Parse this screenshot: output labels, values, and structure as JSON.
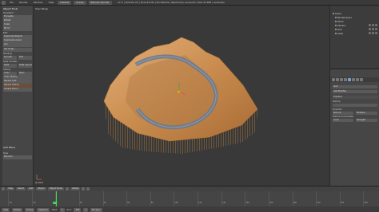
{
  "topbar": {
    "menus": [
      "File",
      "Render",
      "Window",
      "Help"
    ],
    "layout": "Default",
    "scene": "Scene",
    "engine": "Blender Render",
    "info": "v2.77 | Verts:62,172 | Faces:53,261 | Tris:106,522 | Objects:0/4 | Lamps:0/1 | Mem:43.90M | Landscape"
  },
  "left_panel": {
    "section": "Object Tools",
    "transform_label": "Transform:",
    "buttons": [
      "Translate",
      "Rotate",
      "Scale",
      "Mirror"
    ],
    "edit_label": "Edit:",
    "edit_buttons": [
      "Duplicate Objects",
      "Duplicate Linked",
      "Join"
    ],
    "set_origin": "Set Origin",
    "shading_label": "Shading:",
    "smooth": "Smooth",
    "flat": "Flat",
    "data_transfer_label": "Data Transfer:",
    "data_btn": "Data",
    "data_layout_btn": "Data Layout",
    "history_label": "History:",
    "undo": "Undo",
    "redo": "Redo",
    "undo_history": "Undo History",
    "repeat_last": "Repeat Last",
    "repeat_history": "Repeat History",
    "grease_pencil": "Grease Pencil",
    "add_plane": "Add Plane",
    "type_label": "Type",
    "type_value": "Random"
  },
  "viewport": {
    "label": "User Persp",
    "object_label": "(1) Grid"
  },
  "outliner": {
    "rows": [
      {
        "label": "Scene",
        "color": "grey"
      },
      {
        "label": "RenderLayers",
        "color": "grey"
      },
      {
        "label": "World",
        "color": "grey"
      },
      {
        "label": "Camera",
        "color": "grey"
      },
      {
        "label": "Grid",
        "color": "orange"
      },
      {
        "label": "Lamp",
        "color": "grey"
      }
    ]
  },
  "properties": {
    "object_name": "Grid",
    "modifier_button": "Add Modifier",
    "modifier_name": "Displace",
    "texture_label": "Texture",
    "direction_label": "Direction",
    "direction_value": "Normal",
    "texture_coords_label": "Texture Coordinates",
    "coords_value": "Local",
    "midlevel_label": "Midlevel",
    "strength_label": "Strength"
  },
  "view_header": {
    "view": "View",
    "select": "Select",
    "add": "Add",
    "object": "Object",
    "mode": "Object Mode",
    "pivot": "Global"
  },
  "timeline": {
    "ticks": [
      "-40",
      "-20",
      "0",
      "20",
      "40",
      "60",
      "80",
      "100",
      "120",
      "140",
      "160",
      "180",
      "200",
      "220",
      "240",
      "260"
    ],
    "current_frame": "1"
  },
  "timeline_footer": {
    "view": "View",
    "marker": "Marker",
    "frame": "Frame",
    "playback": "Playback",
    "start_label": "Start:",
    "start": "1",
    "end_label": "End:",
    "end": "250",
    "current": "1",
    "sync": "No Sync"
  },
  "colors": {
    "terrain": "#d79a58",
    "wire": "#e89a3a",
    "road": "#6a7a8e",
    "accent": "#3ce05a"
  }
}
